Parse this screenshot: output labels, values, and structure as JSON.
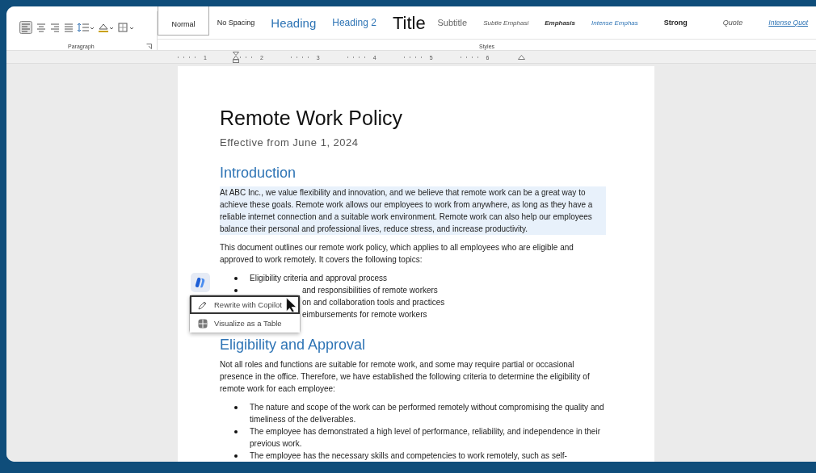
{
  "ribbon": {
    "paragraph_group": {
      "label": "Paragraph"
    },
    "styles_group": {
      "label": "Styles",
      "styles": [
        {
          "label": "Normal",
          "kind": "normal",
          "selected": true
        },
        {
          "label": "No Spacing",
          "kind": "normal",
          "selected": false
        },
        {
          "label": "Heading",
          "kind": "heading1",
          "selected": false
        },
        {
          "label": "Heading 2",
          "kind": "heading2",
          "selected": false
        },
        {
          "label": "Title",
          "kind": "title",
          "selected": false
        },
        {
          "label": "Subtitle",
          "kind": "subtitle",
          "selected": false
        },
        {
          "label": "Subtle Emphasi",
          "kind": "subtle",
          "selected": false
        },
        {
          "label": "Emphasis",
          "kind": "emphasis",
          "selected": false
        },
        {
          "label": "Intense Emphas",
          "kind": "intense",
          "selected": false
        },
        {
          "label": "Strong",
          "kind": "strong",
          "selected": false
        },
        {
          "label": "Quote",
          "kind": "quote",
          "selected": false
        },
        {
          "label": "Intense Quot",
          "kind": "intensequote",
          "selected": false
        }
      ]
    }
  },
  "ruler": {
    "numbers": [
      "1",
      "2",
      "3",
      "4",
      "5",
      "6"
    ]
  },
  "document": {
    "title": "Remote Work Policy",
    "subtitle": "Effective from June 1, 2024",
    "sections": [
      {
        "heading": "Introduction",
        "blocks": [
          {
            "kind": "paragraph",
            "highlighted": true,
            "text": "At ABC Inc., we value flexibility and innovation, and we believe that remote work can be a great way to achieve these goals. Remote work allows our employees to work from anywhere, as long as they have a reliable internet connection and a suitable work environment. Remote work can also help our employees balance their personal and professional lives, reduce stress, and increase productivity."
          },
          {
            "kind": "paragraph",
            "highlighted": false,
            "text": "This document outlines our remote work policy, which applies to all employees who are eligible and approved to work remotely. It covers the following topics:"
          },
          {
            "kind": "bullets",
            "items": [
              {
                "text": "Eligibility criteria and approval process",
                "kind": "plain"
              },
              {
                "text": "and responsibilities of remote workers",
                "kind": "covered"
              },
              {
                "text": "on and collaboration tools and practices",
                "kind": "covered"
              },
              {
                "text": "eimbursements for remote workers",
                "kind": "covered"
              }
            ]
          }
        ]
      },
      {
        "heading": "Eligibility and Approval",
        "blocks": [
          {
            "kind": "paragraph",
            "highlighted": false,
            "text": "Not all roles and functions are suitable for remote work, and some may require partial or occasional presence in the office. Therefore, we have established the following criteria to determine the eligibility of remote work for each employee:"
          },
          {
            "kind": "bullets",
            "items": [
              {
                "text": "The nature and scope of the work can be performed remotely without compromising the quality and timeliness of the deliverables.",
                "kind": "plain"
              },
              {
                "text": "The employee has demonstrated a high level of performance, reliability, and independence in their previous work.",
                "kind": "plain"
              },
              {
                "text": "The employee has the necessary skills and competencies to work remotely, such as self-",
                "kind": "plain"
              }
            ]
          }
        ]
      }
    ]
  },
  "copilot_menu": {
    "items": [
      {
        "label": "Rewrite with Copilot",
        "kind": "rewrite",
        "selected": true
      },
      {
        "label": "Visualize as a Table",
        "kind": "table",
        "selected": false
      }
    ]
  }
}
